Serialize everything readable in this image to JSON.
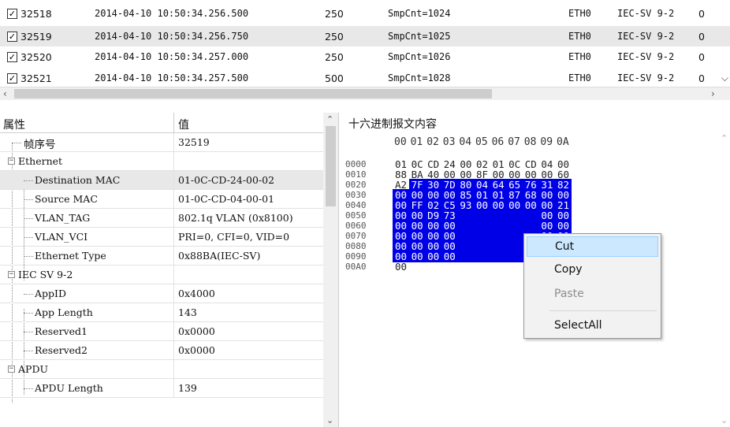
{
  "packets": [
    {
      "checked": true,
      "id": "32518",
      "time": "2014-04-10 10:50:34.256.500",
      "length": "250",
      "info": "SmpCnt=1024",
      "port": "ETH0",
      "protocol": "IEC-SV 9-2",
      "extra": "0"
    },
    {
      "checked": true,
      "id": "32519",
      "time": "2014-04-10 10:50:34.256.750",
      "length": "250",
      "info": "SmpCnt=1025",
      "port": "ETH0",
      "protocol": "IEC-SV 9-2",
      "extra": "0"
    },
    {
      "checked": true,
      "id": "32520",
      "time": "2014-04-10 10:50:34.257.000",
      "length": "250",
      "info": "SmpCnt=1026",
      "port": "ETH0",
      "protocol": "IEC-SV 9-2",
      "extra": "0"
    },
    {
      "checked": true,
      "id": "32521",
      "time": "2014-04-10 10:50:34.257.500",
      "length": "500",
      "info": "SmpCnt=1028",
      "port": "ETH0",
      "protocol": "IEC-SV 9-2",
      "extra": "0"
    }
  ],
  "property_grid": {
    "header_name": "属性",
    "header_value": "值",
    "rows": [
      {
        "name": "帧序号",
        "value": "32519"
      },
      {
        "name": "Ethernet",
        "value": ""
      },
      {
        "name": "Destination MAC",
        "value": "01-0C-CD-24-00-02"
      },
      {
        "name": "Source MAC",
        "value": "01-0C-CD-04-00-01"
      },
      {
        "name": "VLAN_TAG",
        "value": "802.1q VLAN (0x8100)"
      },
      {
        "name": "VLAN_VCI",
        "value": "PRI=0, CFI=0, VID=0"
      },
      {
        "name": "Ethernet Type",
        "value": "0x88BA(IEC-SV)"
      },
      {
        "name": "IEC SV 9-2",
        "value": ""
      },
      {
        "name": "AppID",
        "value": "0x4000"
      },
      {
        "name": "App Length",
        "value": "143"
      },
      {
        "name": "Reserved1",
        "value": "0x0000"
      },
      {
        "name": "Reserved2",
        "value": "0x0000"
      },
      {
        "name": "APDU",
        "value": ""
      },
      {
        "name": "APDU Length",
        "value": "139"
      }
    ]
  },
  "hex_view": {
    "title": "十六进制报文内容",
    "column_headers": [
      "00",
      "01",
      "02",
      "03",
      "04",
      "05",
      "06",
      "07",
      "08",
      "09",
      "0A"
    ],
    "rows": [
      {
        "offset": "0000",
        "bytes": [
          "01",
          "0C",
          "CD",
          "24",
          "00",
          "02",
          "01",
          "0C",
          "CD",
          "04",
          "00"
        ]
      },
      {
        "offset": "0010",
        "bytes": [
          "88",
          "BA",
          "40",
          "00",
          "00",
          "8F",
          "00",
          "00",
          "00",
          "00",
          "60"
        ]
      },
      {
        "offset": "0020",
        "bytes": [
          "A2",
          "7F",
          "30",
          "7D",
          "80",
          "04",
          "64",
          "65",
          "76",
          "31",
          "82"
        ]
      },
      {
        "offset": "0030",
        "bytes": [
          "00",
          "00",
          "00",
          "00",
          "85",
          "01",
          "01",
          "87",
          "68",
          "00",
          "00"
        ]
      },
      {
        "offset": "0040",
        "bytes": [
          "00",
          "FF",
          "02",
          "C5",
          "93",
          "00",
          "00",
          "00",
          "00",
          "00",
          "21"
        ]
      },
      {
        "offset": "0050",
        "bytes": [
          "00",
          "00",
          "D9",
          "73",
          "",
          "",
          "",
          "",
          "",
          "00",
          "00"
        ]
      },
      {
        "offset": "0060",
        "bytes": [
          "00",
          "00",
          "00",
          "00",
          "",
          "",
          "",
          "",
          "",
          "00",
          "00"
        ]
      },
      {
        "offset": "0070",
        "bytes": [
          "00",
          "00",
          "00",
          "00",
          "",
          "",
          "",
          "",
          "",
          "00",
          "00"
        ]
      },
      {
        "offset": "0080",
        "bytes": [
          "00",
          "00",
          "00",
          "00",
          "",
          "",
          "",
          "",
          "",
          "00",
          "00"
        ]
      },
      {
        "offset": "0090",
        "bytes": [
          "00",
          "00",
          "00",
          "00",
          "",
          "",
          "",
          "",
          "",
          "00",
          "00"
        ]
      },
      {
        "offset": "00A0",
        "bytes": [
          "00"
        ]
      }
    ]
  },
  "context_menu": {
    "items": [
      {
        "label": "Cut",
        "state": "hover"
      },
      {
        "label": "Copy",
        "state": "normal"
      },
      {
        "label": "Paste",
        "state": "disabled"
      },
      {
        "label": "SelectAll",
        "state": "normal"
      }
    ]
  },
  "colors": {
    "selection_blue": "#0000e6",
    "row_selected": "#e8e8e8",
    "menu_hover": "#cce8ff"
  }
}
